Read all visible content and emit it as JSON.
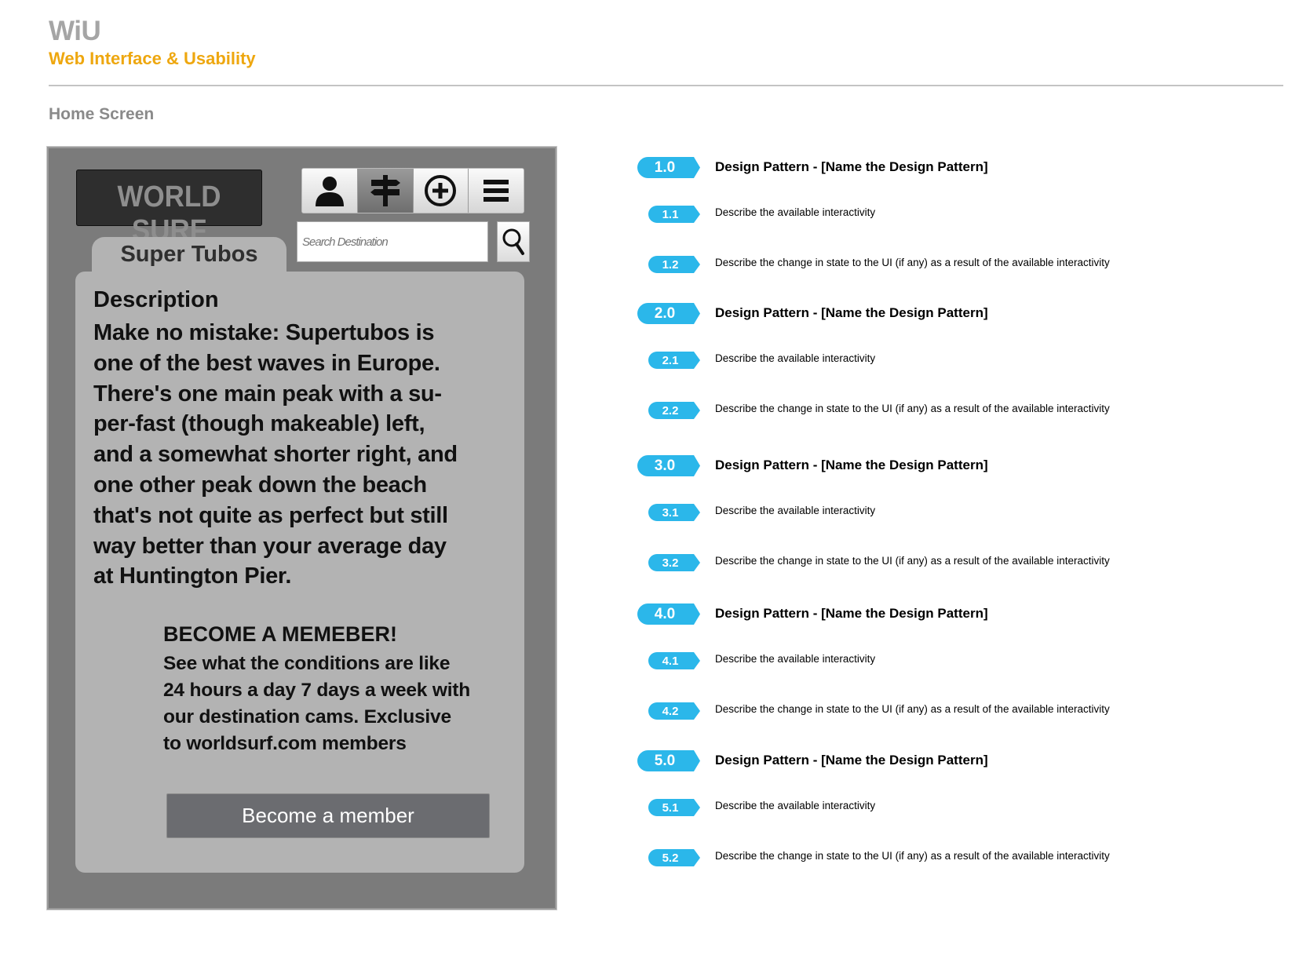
{
  "header": {
    "brand": "WiU",
    "subtitle": "Web Interface & Usability",
    "screen_title": "Home Screen"
  },
  "app": {
    "logo_text": "WORLD SURF",
    "nav_icons": [
      "user-icon",
      "signpost-icon",
      "add-circle-icon",
      "menu-icon"
    ],
    "active_nav_index": 1,
    "search": {
      "placeholder": "Search Destination",
      "value": ""
    },
    "tab_label": "Super Tubos",
    "description_heading": "Description",
    "description_lines": [
      "Make no mistake: Supertubos is",
      "one of the best waves in Europe.",
      "There's one main peak with a su-",
      "per-fast (though makeable) left,",
      "and a somewhat shorter right, and",
      "one other peak down the beach",
      "that's not quite as perfect but still",
      "way better than your average day",
      "at Huntington Pier."
    ],
    "member_heading": "BECOME A MEMEBER!",
    "member_lines": [
      "See what the conditions are like",
      "24 hours a day 7 days a week with",
      "our destination cams. Exclusive",
      "to worldsurf.com members"
    ],
    "member_button": "Become a member"
  },
  "annotations": [
    {
      "id": "1.0",
      "level": "major",
      "text": "Design Pattern - [Name the Design Pattern]"
    },
    {
      "id": "1.1",
      "level": "minor",
      "text": "Describe the available interactivity"
    },
    {
      "id": "1.2",
      "level": "minor",
      "text": "Describe the change in state to the UI (if any) as a result of the available interactivity"
    },
    {
      "id": "2.0",
      "level": "major",
      "text": "Design Pattern - [Name the Design Pattern]"
    },
    {
      "id": "2.1",
      "level": "minor",
      "text": "Describe the available interactivity"
    },
    {
      "id": "2.2",
      "level": "minor",
      "text": "Describe the change in state to the UI (if any) as a result of the available interactivity"
    },
    {
      "id": "3.0",
      "level": "major",
      "text": "Design Pattern - [Name the Design Pattern]"
    },
    {
      "id": "3.1",
      "level": "minor",
      "text": "Describe the available interactivity"
    },
    {
      "id": "3.2",
      "level": "minor",
      "text": "Describe the change in state to the UI (if any) as a result of the available interactivity"
    },
    {
      "id": "4.0",
      "level": "major",
      "text": "Design Pattern - [Name the Design Pattern]"
    },
    {
      "id": "4.1",
      "level": "minor",
      "text": "Describe the available interactivity"
    },
    {
      "id": "4.2",
      "level": "minor",
      "text": "Describe the change in state to the UI (if any) as a result of the available interactivity"
    },
    {
      "id": "5.0",
      "level": "major",
      "text": "Design Pattern - [Name the Design Pattern]"
    },
    {
      "id": "5.1",
      "level": "minor",
      "text": "Describe the available interactivity"
    },
    {
      "id": "5.2",
      "level": "minor",
      "text": "Describe the change in state to the UI (if any) as a result of the available interactivity"
    }
  ],
  "colors": {
    "brand_gray": "#a5a5a5",
    "subtitle_orange": "#eea70f",
    "tag_blue": "#2bb7ea",
    "phone_bg": "#7b7b7b",
    "card_bg": "#b3b3b3",
    "button_bg": "#6b6c70"
  }
}
